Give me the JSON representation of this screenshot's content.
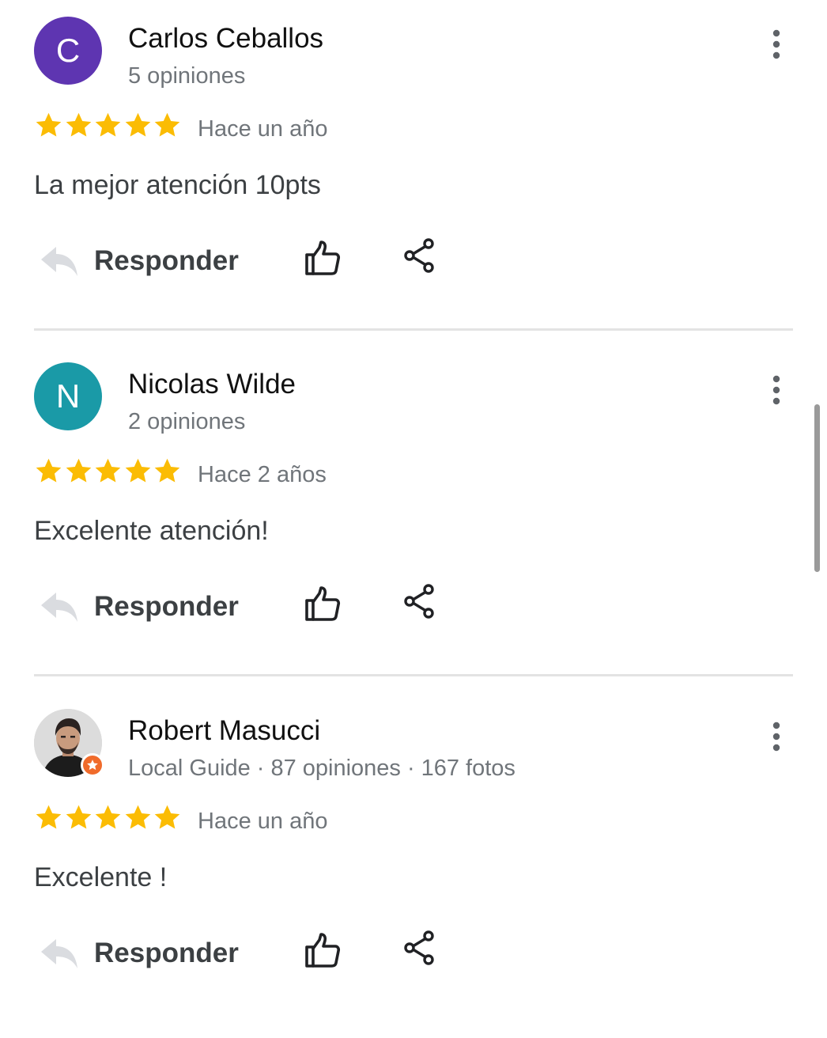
{
  "colors": {
    "star": "#fbbc04",
    "avatar_carlos": "#5e35b1",
    "avatar_nicolas": "#1a9aa7",
    "local_guide_badge": "#f06b2b"
  },
  "reviews": [
    {
      "author": "Carlos Ceballos",
      "avatar_letter": "C",
      "meta": "5 opiniones",
      "rating": 5,
      "time": "Hace un año",
      "text": "La mejor atención 10pts",
      "reply_label": "Responder"
    },
    {
      "author": "Nicolas Wilde",
      "avatar_letter": "N",
      "meta": "2 opiniones",
      "rating": 5,
      "time": "Hace 2 años",
      "text": "Excelente atención!",
      "reply_label": "Responder"
    },
    {
      "author": "Robert Masucci",
      "avatar_letter": "",
      "meta_parts": [
        "Local Guide",
        "87 opiniones",
        "167 fotos"
      ],
      "meta_separator": "·",
      "rating": 5,
      "time": "Hace un año",
      "text": "Excelente !",
      "reply_label": "Responder"
    }
  ]
}
